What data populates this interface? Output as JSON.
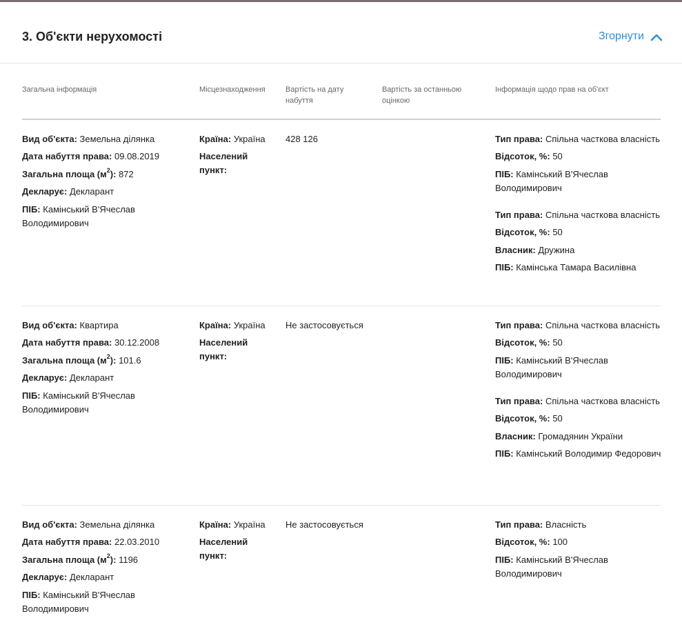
{
  "section": {
    "title": "3. Об'єкти нерухомості",
    "collapse_label": "Згорнути"
  },
  "columns": [
    "Загальна інформація",
    "Місцезнаходження",
    "Вартість на дату набуття",
    "Вартість за останньою оцінкою",
    "Інформація щодо прав на об'єкт"
  ],
  "labels": {
    "object_type": "Вид об'єкта:",
    "acquired_date": "Дата набуття права:",
    "area_prefix": "Загальна площа (м",
    "area_sup": "2",
    "area_suffix": "):",
    "declares": "Декларує:",
    "pib": "ПІБ:",
    "country": "Країна:",
    "settlement": "Населений пункт:",
    "right_type": "Тип права:",
    "percent": "Відсоток, %:",
    "owner": "Власник:"
  },
  "rows": [
    {
      "object_type": "Земельна ділянка",
      "acquired_date": "09.08.2019",
      "area": "872",
      "declares": "Декларант",
      "pib": "Камінський В'Ячеслав Володимирович",
      "country": "Україна",
      "value_at_acquisition": "428 126",
      "value_last_assessment": "",
      "rights": [
        {
          "type": "Спільна часткова власність",
          "percent": "50",
          "owner": "",
          "pib": "Камінський В'Ячеслав Володимирович"
        },
        {
          "type": "Спільна часткова власність",
          "percent": "50",
          "owner": "Дружина",
          "pib": "Камінська Тамара Василівна"
        }
      ]
    },
    {
      "object_type": "Квартира",
      "acquired_date": "30.12.2008",
      "area": "101.6",
      "declares": "Декларант",
      "pib": "Камінський В'Ячеслав Володимирович",
      "country": "Україна",
      "value_at_acquisition": "Не застосовується",
      "value_last_assessment": "",
      "rights": [
        {
          "type": "Спільна часткова власність",
          "percent": "50",
          "owner": "",
          "pib": "Камінський В'Ячеслав Володимирович"
        },
        {
          "type": "Спільна часткова власність",
          "percent": "50",
          "owner": "Громадянин України",
          "pib": "Камінський Володимир Федорович"
        }
      ]
    },
    {
      "object_type": "Земельна ділянка",
      "acquired_date": "22.03.2010",
      "area": "1196",
      "declares": "Декларант",
      "pib": "Камінський В'Ячеслав Володимирович",
      "country": "Україна",
      "value_at_acquisition": "Не застосовується",
      "value_last_assessment": "",
      "rights": [
        {
          "type": "Власність",
          "percent": "100",
          "owner": "",
          "pib": "Камінський В'Ячеслав Володимирович"
        }
      ]
    }
  ],
  "colors": {
    "accent": "#2a8fd4",
    "top_bar": "#7d7073",
    "muted_text": "#666666"
  }
}
